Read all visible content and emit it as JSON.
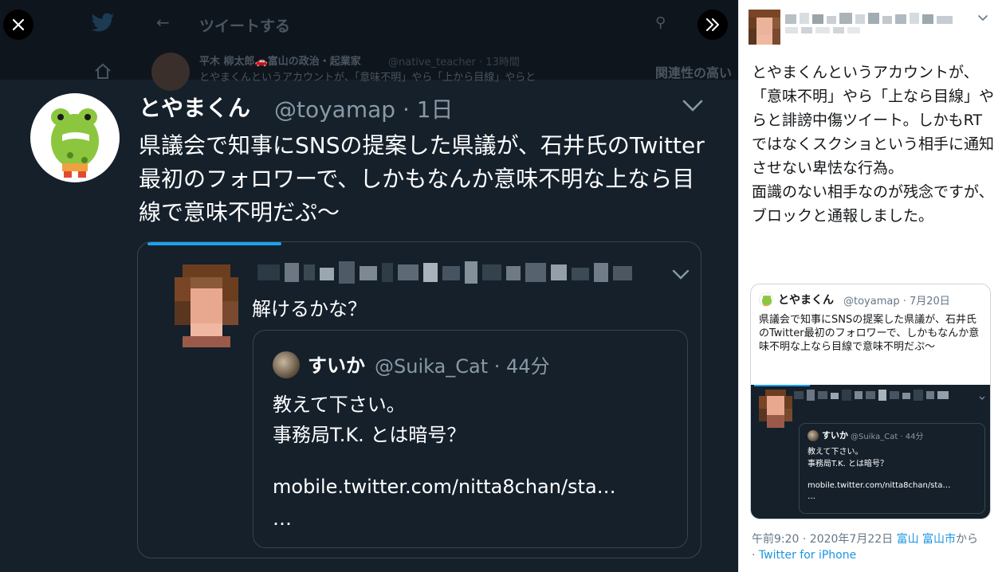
{
  "background": {
    "title": "ツイートする",
    "author": "平木 柳太郎🚗富山の政治・起業家",
    "handle": "@native_teacher · 13時間",
    "snippet": "とやまくんというアカウントが、「意味不明」やら「上から目線」やらと",
    "related": "関連性の高い"
  },
  "tweet": {
    "name": "とやまくん",
    "handle_time": "@toyamap · 1日",
    "body": "県議会で知事にSNSの提案した県議が、石井氏のTwitter最初のフォロワーで、しかもなんか意味不明な上なら目線で意味不明だぷ〜"
  },
  "quoted": {
    "text": "解けるかな？",
    "inner": {
      "name": "すいか",
      "handle_time": "@Suika_Cat · 44分",
      "line1": "教えて下さい。",
      "line2": "事務局T.K.  とは暗号？",
      "link": "mobile.twitter.com/nitta8chan/sta…",
      "ellipsis": "…"
    }
  },
  "panel": {
    "text": "とやまくんというアカウントが、「意味不明」やら「上なら目線」やらと誹謗中傷ツイート。しかもRTではなくスクショという相手に通知させない卑怯な行為。\n面識のない相手なのが残念ですが、ブロックと通報しました。",
    "card": {
      "name": "とやまくん",
      "handle_time": "@toyamap · 7月20日",
      "body": "県議会で知事にSNSの提案した県議が、石井氏のTwitter最初のフォロワーで、しかもなんか意味不明な上なら目線で意味不明だぷ〜",
      "media_inner": {
        "name": "すいか",
        "handle_time": "@Suika_Cat · 44分",
        "line1": "教えて下さい。",
        "line2": "事務局T.K.  とは暗号？",
        "link": "mobile.twitter.com/nitta8chan/sta…",
        "ellipsis": "…"
      }
    },
    "footer": {
      "time": "午前9:20 · 2020年7月22日",
      "loc1": "富山",
      "loc2": "富山市",
      "from": "から",
      "dot": "·",
      "source": "Twitter for iPhone"
    }
  },
  "colors": {
    "viewer_bg": "#15202b",
    "accent": "#1da1f2",
    "link": "#1b95e0",
    "muted": "#8899a6"
  },
  "icons": [
    "close-icon",
    "expand-icon",
    "chevron-down-icon",
    "twitter-bird-icon",
    "back-arrow-icon",
    "home-icon",
    "search-icon"
  ]
}
